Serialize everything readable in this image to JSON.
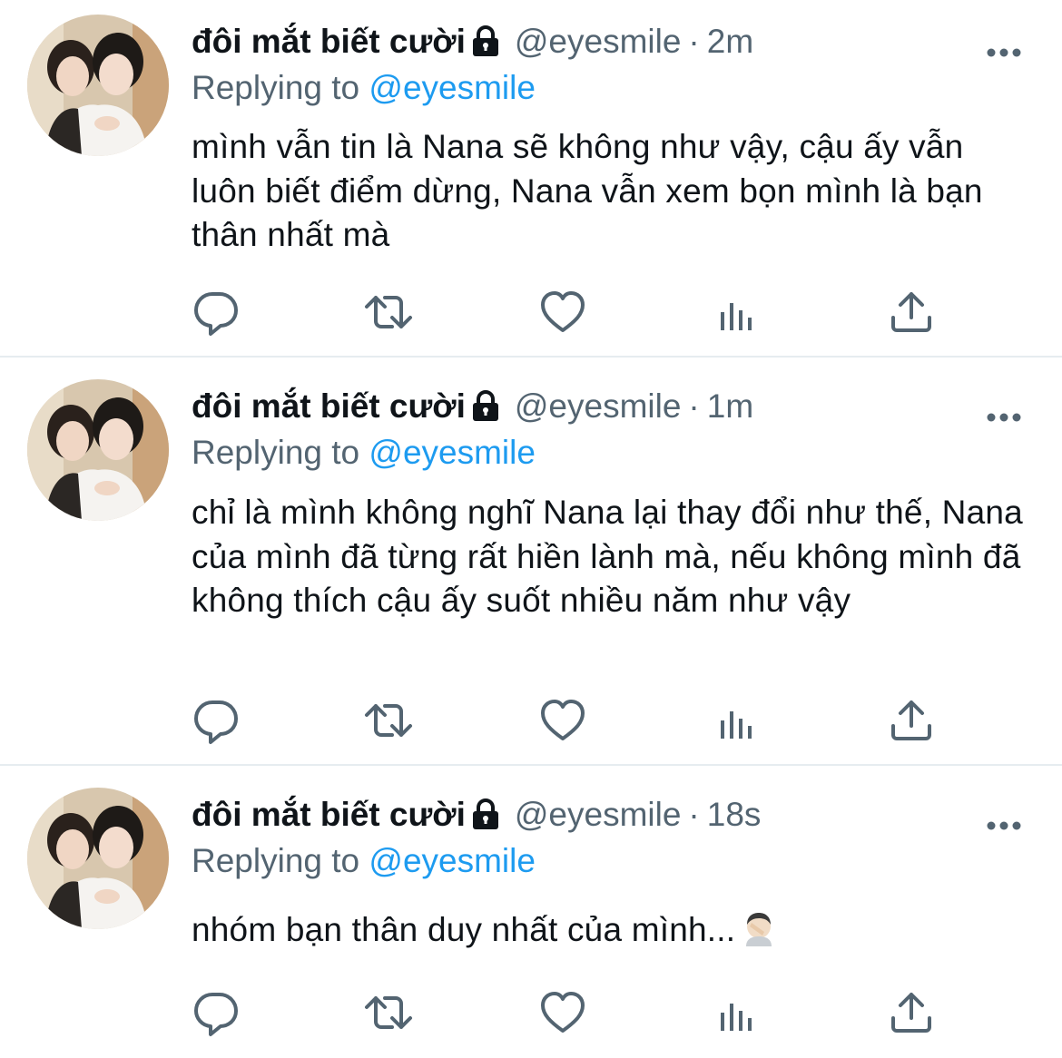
{
  "tweets": [
    {
      "name": "đôi mắt biết cười",
      "handle": "@eyesmile",
      "separator": "·",
      "time": "2m",
      "replying_label": "Replying to",
      "replying_to": "@eyesmile",
      "text": "mình vẫn tin là Nana sẽ không như vậy, cậu ấy vẫn luôn biết điểm dừng, Nana vẫn xem bọn mình là bạn thân nhất mà"
    },
    {
      "name": "đôi mắt biết cười",
      "handle": "@eyesmile",
      "separator": "·",
      "time": "1m",
      "replying_label": "Replying to",
      "replying_to": "@eyesmile",
      "text": "chỉ là mình không nghĩ Nana lại thay đổi như thế, Nana của mình đã từng rất hiền lành mà, nếu không mình đã không thích cậu ấy suốt nhiều năm như vậy"
    },
    {
      "name": "đôi mắt biết cười",
      "handle": "@eyesmile",
      "separator": "·",
      "time": "18s",
      "replying_label": "Replying to",
      "replying_to": "@eyesmile",
      "text": "nhóm bạn thân duy nhất của mình...",
      "emoji": "face-palm-emoji"
    }
  ],
  "icons": {
    "reply": "reply-icon",
    "retweet": "retweet-icon",
    "like": "heart-icon",
    "analytics": "analytics-icon",
    "share": "share-icon",
    "more": "more-icon",
    "lock": "lock-icon"
  },
  "colors": {
    "text": "#0f1419",
    "secondary": "#536471",
    "link": "#1d9bf0",
    "divider": "#e6ecf0"
  }
}
